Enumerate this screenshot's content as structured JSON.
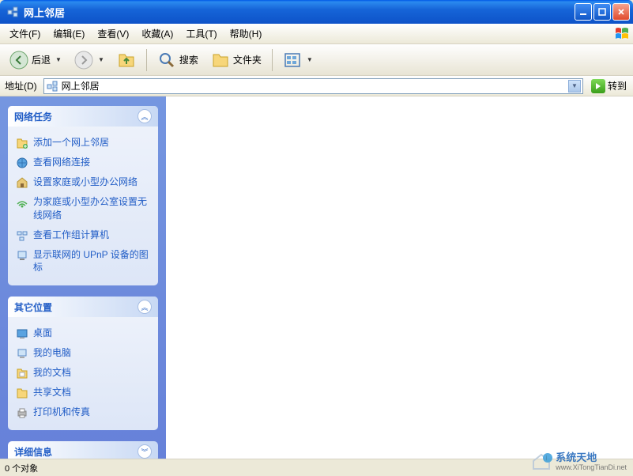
{
  "title": "网上邻居",
  "menu": {
    "file": "文件(F)",
    "edit": "编辑(E)",
    "view": "查看(V)",
    "favorites": "收藏(A)",
    "tools": "工具(T)",
    "help": "帮助(H)"
  },
  "toolbar": {
    "back": "后退",
    "search": "搜索",
    "folders": "文件夹"
  },
  "address": {
    "label": "地址(D)",
    "value": "网上邻居",
    "go": "转到"
  },
  "panels": {
    "networkTasks": {
      "title": "网络任务",
      "items": [
        "添加一个网上邻居",
        "查看网络连接",
        "设置家庭或小型办公网络",
        "为家庭或小型办公室设置无线网络",
        "查看工作组计算机",
        "显示联网的 UPnP 设备的图标"
      ]
    },
    "otherPlaces": {
      "title": "其它位置",
      "items": [
        "桌面",
        "我的电脑",
        "我的文档",
        "共享文档",
        "打印机和传真"
      ]
    },
    "details": {
      "title": "详细信息"
    }
  },
  "status": "0 个对象",
  "watermark": {
    "cn": "系统天地",
    "en": "www.XiTongTianDi.net"
  }
}
